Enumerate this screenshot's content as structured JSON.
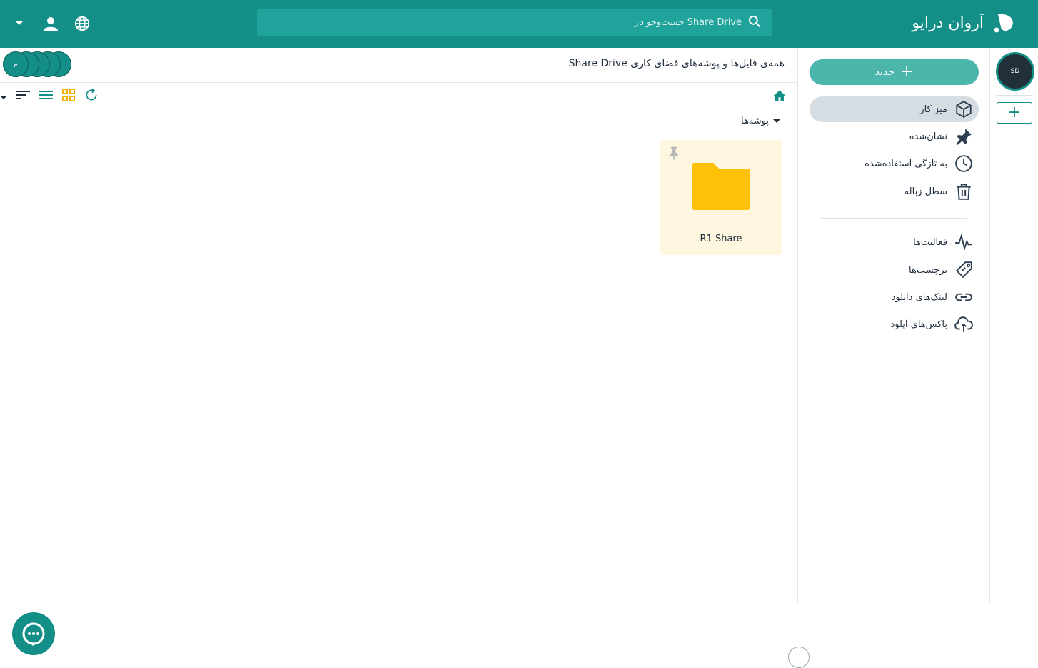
{
  "app": {
    "name": "آروان درایو",
    "brand_color": "#138f87"
  },
  "search": {
    "placeholder": "جست‌وجو در Share Drive"
  },
  "header_icons": [
    "language-icon",
    "user-icon",
    "dropdown-caret-icon"
  ],
  "rail": {
    "workspace_avatar": "SD",
    "add_label": "+"
  },
  "sidebar": {
    "new_label": "جدید",
    "items": [
      {
        "label": "میز کار",
        "icon": "cube-icon",
        "active": true
      },
      {
        "label": "نشان‌شده",
        "icon": "pin-icon"
      },
      {
        "label": "به تازگی استفاده‌شده",
        "icon": "clock-icon"
      },
      {
        "label": "سطل زباله",
        "icon": "trash-icon"
      },
      {
        "label": "فعالیت‌ها",
        "icon": "activity-icon"
      },
      {
        "label": "برچسب‌ها",
        "icon": "tag-icon"
      },
      {
        "label": "لینک‌های دانلود",
        "icon": "link-icon"
      },
      {
        "label": "باکس‌های آپلود",
        "icon": "cloud-upload-icon"
      }
    ]
  },
  "main": {
    "title": "همه‌ی فایل‌ها و پوشه‌های فضای کاری Share Drive",
    "members_initial": "م",
    "section_label": "پوشه‌ها",
    "folders": [
      {
        "name": "R1 Share",
        "color": "#ffc107",
        "pinned": true
      }
    ],
    "toolbar_icons": [
      "refresh-icon",
      "grid-view-icon",
      "list-view-icon",
      "sort-icon",
      "dropdown-caret-icon"
    ]
  }
}
